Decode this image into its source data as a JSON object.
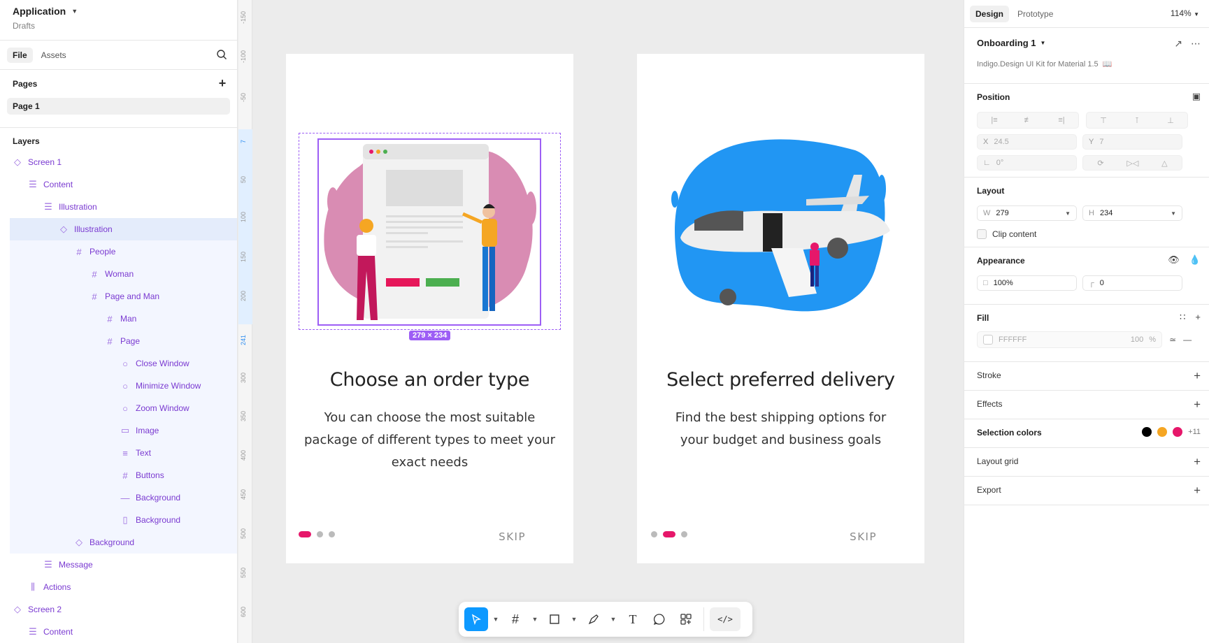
{
  "app": {
    "title": "Application",
    "subtitle": "Drafts"
  },
  "left_tabs": [
    "File",
    "Assets"
  ],
  "pages": {
    "label": "Pages",
    "items": [
      "Page 1"
    ]
  },
  "layers": {
    "label": "Layers",
    "items": [
      {
        "name": "Screen 1",
        "icon": "component-icon",
        "depth": 0,
        "state": ""
      },
      {
        "name": "Content",
        "icon": "autolayout-icon",
        "depth": 1,
        "state": ""
      },
      {
        "name": "Illustration",
        "icon": "autolayout-icon",
        "depth": 2,
        "state": ""
      },
      {
        "name": "Illustration",
        "icon": "component-icon",
        "depth": 3,
        "state": "selected"
      },
      {
        "name": "People",
        "icon": "frame-icon",
        "depth": 4,
        "state": "group"
      },
      {
        "name": "Woman",
        "icon": "frame-icon",
        "depth": 5,
        "state": "group"
      },
      {
        "name": "Page and Man",
        "icon": "frame-icon",
        "depth": 5,
        "state": "group"
      },
      {
        "name": "Man",
        "icon": "frame-icon",
        "depth": 6,
        "state": "group"
      },
      {
        "name": "Page",
        "icon": "frame-icon",
        "depth": 6,
        "state": "group"
      },
      {
        "name": "Close Window",
        "icon": "ellipse-icon",
        "depth": 7,
        "state": "group"
      },
      {
        "name": "Minimize Window",
        "icon": "ellipse-icon",
        "depth": 7,
        "state": "group"
      },
      {
        "name": "Zoom Window",
        "icon": "ellipse-icon",
        "depth": 7,
        "state": "group"
      },
      {
        "name": "Image",
        "icon": "rect-icon",
        "depth": 7,
        "state": "group"
      },
      {
        "name": "Text",
        "icon": "text-lines-icon",
        "depth": 7,
        "state": "group"
      },
      {
        "name": "Buttons",
        "icon": "frame-icon",
        "depth": 7,
        "state": "group"
      },
      {
        "name": "Background",
        "icon": "line-icon",
        "depth": 7,
        "state": "group"
      },
      {
        "name": "Background",
        "icon": "vector-rect-icon",
        "depth": 7,
        "state": "group"
      },
      {
        "name": "Background",
        "icon": "component-icon",
        "depth": 4,
        "state": "group"
      },
      {
        "name": "Message",
        "icon": "autolayout-icon",
        "depth": 2,
        "state": ""
      },
      {
        "name": "Actions",
        "icon": "autolayout-h-icon",
        "depth": 1,
        "state": ""
      },
      {
        "name": "Screen 2",
        "icon": "component-icon",
        "depth": 0,
        "state": ""
      },
      {
        "name": "Content",
        "icon": "autolayout-icon",
        "depth": 1,
        "state": ""
      }
    ]
  },
  "ruler": {
    "ticks": [
      "-150",
      "-100",
      "-50",
      "7",
      "50",
      "100",
      "150",
      "200",
      "241",
      "300",
      "350",
      "400",
      "450",
      "500",
      "550",
      "600"
    ],
    "highlight": [
      "7",
      "241"
    ]
  },
  "frames": [
    {
      "title": "Choose an order type",
      "description": "You can choose the most suitable package of different types to meet your exact needs",
      "active_dot": 0,
      "skip": "SKIP",
      "selection_size": "279 × 234"
    },
    {
      "title": "Select preferred delivery",
      "description": "Find the best shipping options for your budget and business goals",
      "active_dot": 1,
      "skip": "SKIP"
    }
  ],
  "toolbar": [
    "move-tool-icon",
    "frame-tool-icon",
    "shape-tool-icon",
    "pen-tool-icon",
    "text-tool-icon",
    "comment-tool-icon",
    "actions-tool-icon",
    "dev-mode-icon"
  ],
  "right": {
    "tabs": [
      "Design",
      "Prototype"
    ],
    "zoom": "114%",
    "component": {
      "name": "Onboarding 1",
      "library": "Indigo.Design UI Kit for Material 1.5"
    },
    "position": {
      "label": "Position",
      "x": "24.5",
      "y": "7",
      "rotation": "0°"
    },
    "layout": {
      "label": "Layout",
      "w": "279",
      "h": "234",
      "clip": "Clip content"
    },
    "appearance": {
      "label": "Appearance",
      "opacity": "100%",
      "radius": "0"
    },
    "fill": {
      "label": "Fill",
      "hex": "FFFFFF",
      "opacity": "100",
      "unit": "%"
    },
    "stroke": "Stroke",
    "effects": "Effects",
    "selection_colors": {
      "label": "Selection colors",
      "colors": [
        "#000000",
        "#f5a623",
        "#e6176a"
      ],
      "more": "+11"
    },
    "layout_grid": "Layout grid",
    "export": "Export"
  },
  "help": "?",
  "colors": {
    "accent": "#0d99ff",
    "selection": "#9d5ef5",
    "brand_pink": "#e6176a",
    "blob_blue": "#2196f3",
    "blob_pink": "#d98cb3"
  }
}
